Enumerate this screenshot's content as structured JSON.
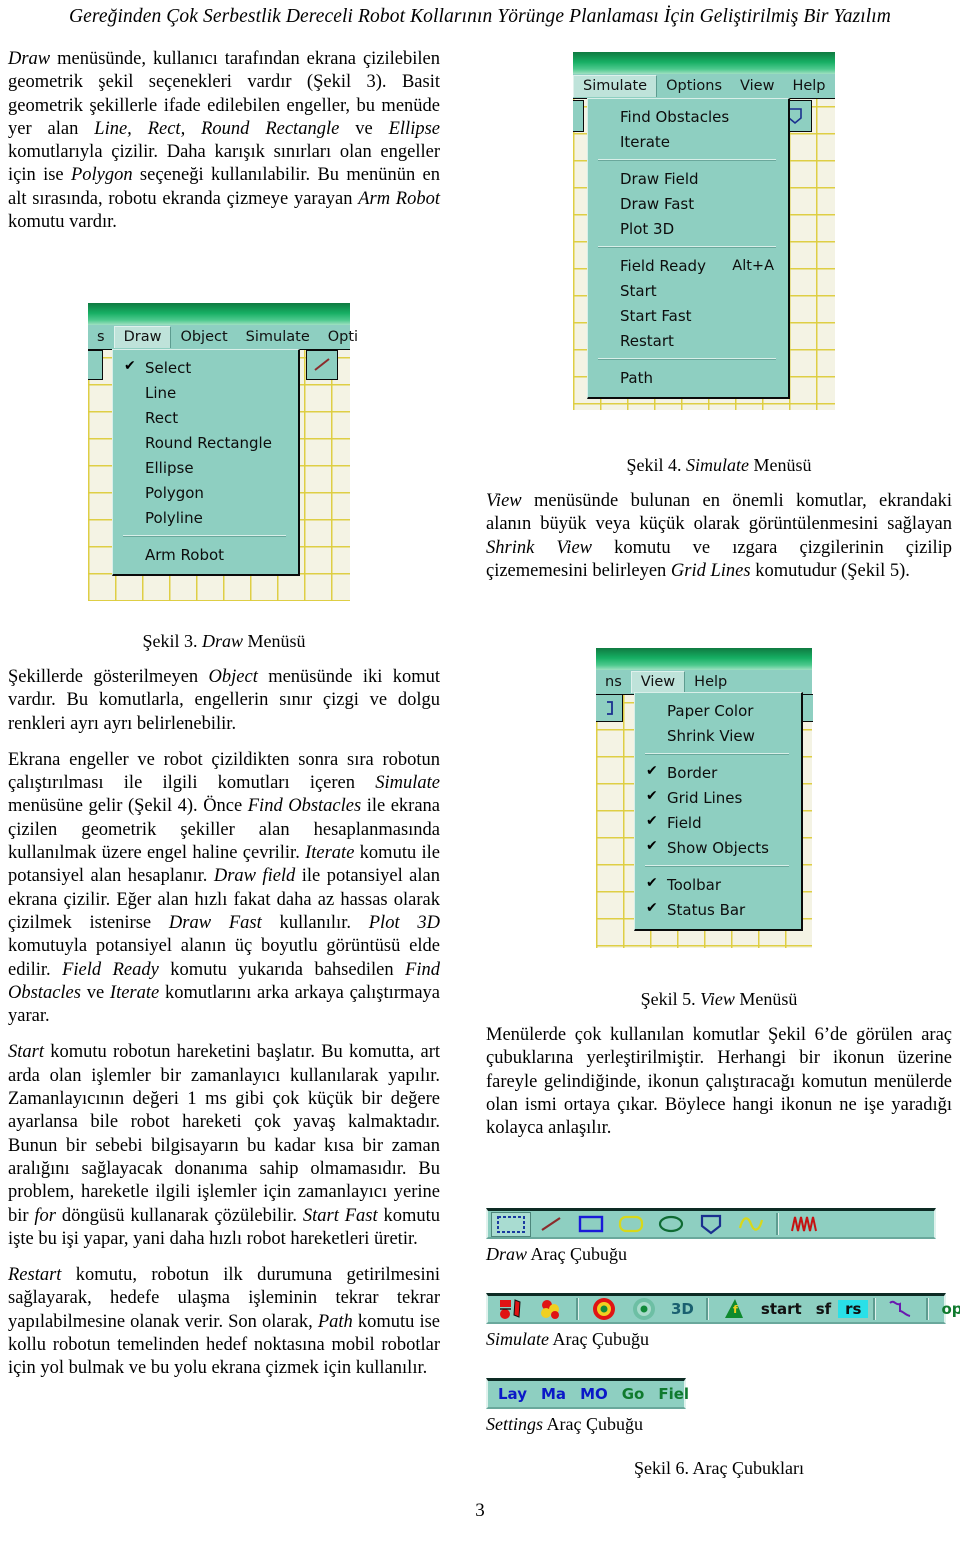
{
  "header": {
    "title": "Gereğinden Çok Serbestlik Dereceli Robot Kollarının Yörünge Planlaması İçin Geliştirilmiş Bir Yazılım"
  },
  "page_number": "3",
  "left_column": {
    "p1_html": "<i>Draw</i> menüsünde, kullanıcı tarafından ekrana çizilebilen geometrik şekil seçenekleri vardır (Şekil 3). Basit geometrik şekillerle ifade edilebilen engeller, bu menüde yer alan <i>Line, Rect, Round Rectangle</i> ve <i>Ellipse</i> komutlarıyla çizilir. Daha karışık sınırları olan engeller için ise <i>Polygon</i> seçeneği kullanılabilir. Bu menünün en alt sırasında, robotu ekranda çizmeye yarayan <i>Arm Robot</i> komutu vardır.",
    "fig3_caption_html": "Şekil 3. <i>Draw</i> Menüsü",
    "p2_html": "Şekillerde gösterilmeyen <i>Object</i> menüsünde iki komut vardır. Bu komutlarla, engellerin sınır çizgi ve dolgu renkleri ayrı ayrı belirlenebilir.",
    "p3_html": "Ekrana engeller ve robot çizildikten sonra sıra robotun çalıştırılması ile ilgili komutları içeren <i>Simulate</i> menüsüne gelir (Şekil 4). Önce <i>Find Obstacles</i> ile ekrana çizilen geometrik şekiller alan hesaplanmasında kullanılmak üzere engel haline çevrilir. <i>Iterate</i> komutu ile potansiyel alan hesaplanır. <i>Draw field</i> ile potansiyel alan ekrana çizilir. Eğer alan hızlı fakat daha az hassas olarak çizilmek istenirse <i>Draw Fast</i> kullanılır. <i>Plot 3D</i> komutuyla potansiyel alanın üç boyutlu görüntüsü elde edilir. <i>Field Ready</i> komutu yukarıda bahsedilen <i>Find Obstacles</i> ve <i>Iterate</i> komutlarını arka arkaya çalıştırmaya yarar.",
    "p4_html": "<i>Start</i> komutu robotun hareketini başlatır. Bu komutta, art arda olan işlemler bir zamanlayıcı kullanılarak yapılır. Zamanlayıcının değeri 1 ms gibi çok küçük bir değere ayarlansa bile robot hareketi çok yavaş kalmaktadır. Bunun bir sebebi bilgisayarın bu kadar kısa bir zaman aralığını sağlayacak donanıma sahip olmamasıdır. Bu problem, hareketle ilgili işlemler için zamanlayıcı yerine bir <i>for</i> döngüsü kullanarak çözülebilir. <i>Start Fast</i> komutu işte bu işi yapar, yani daha hızlı robot hareketleri üretir.",
    "p5_html": "<i>Restart</i> komutu, robotun ilk durumuna getirilmesini sağlayarak, hedefe ulaşma işleminin tekrar tekrar yapılabilmesine olanak verir. Son olarak, <i>Path</i> komutu ise kollu robotun temelinden hedef noktasına mobil robotlar için yol bulmak ve bu yolu ekrana çizmek için kullanılır."
  },
  "right_column": {
    "fig4_caption_html": "Şekil 4. <i>Simulate</i> Menüsü",
    "p1_html": "<i>View</i> menüsünde bulunan en önemli komutlar, ekrandaki alanın büyük veya küçük olarak görüntülenmesini sağlayan <i>Shrink View</i> komutu ve ızgara çizgilerinin çizilip çizememesini belirleyen <i>Grid Lines</i> komutudur (Şekil 5).",
    "fig5_caption_html": "Şekil 5. <i>View</i> Menüsü",
    "p2_html": "Menülerde çok kullanılan komutlar Şekil 6’de görülen araç çubuklarına yerleştirilmiştir. Herhangi bir ikonun üzerine fareyle gelindiğinde, ikonun çalıştıracağı komutun menülerde olan ismi ortaya çıkar. Böylece hangi ikonun ne işe yaradığı kolayca anlaşılır.",
    "draw_toolbar_label_html": "<i>Draw</i> Araç Çubuğu",
    "simulate_toolbar_label_html": "<i>Simulate</i> Araç Çubuğu",
    "settings_toolbar_label_html": "<i>Settings</i> Araç Çubuğu",
    "fig6_caption": "Şekil 6. Araç Çubukları"
  },
  "figure3_draw_menu": {
    "menubar": [
      {
        "label": "s",
        "selected": false
      },
      {
        "label": "Draw",
        "selected": true
      },
      {
        "label": "Object",
        "selected": false
      },
      {
        "label": "Simulate",
        "selected": false
      },
      {
        "label": "Opti",
        "selected": false
      }
    ],
    "items": [
      {
        "label": "Select",
        "checked": true
      },
      {
        "label": "Line",
        "checked": false
      },
      {
        "label": "Rect",
        "checked": false
      },
      {
        "label": "Round Rectangle",
        "checked": false
      },
      {
        "label": "Ellipse",
        "checked": false
      },
      {
        "label": "Polygon",
        "checked": false
      },
      {
        "label": "Polyline",
        "checked": false
      },
      {
        "separator": true
      },
      {
        "label": "Arm Robot",
        "checked": false
      }
    ]
  },
  "figure4_simulate_menu": {
    "menubar": [
      {
        "label": "Simulate",
        "selected": true
      },
      {
        "label": "Options",
        "selected": false
      },
      {
        "label": "View",
        "selected": false
      },
      {
        "label": "Help",
        "selected": false
      }
    ],
    "items": [
      {
        "label": "Find Obstacles",
        "accel": ""
      },
      {
        "label": "Iterate",
        "accel": ""
      },
      {
        "separator": true
      },
      {
        "label": "Draw Field",
        "accel": ""
      },
      {
        "label": "Draw Fast",
        "accel": ""
      },
      {
        "label": "Plot 3D",
        "accel": ""
      },
      {
        "separator": true
      },
      {
        "label": "Field Ready",
        "accel": "Alt+A"
      },
      {
        "label": "Start",
        "accel": ""
      },
      {
        "label": "Start Fast",
        "accel": ""
      },
      {
        "label": "Restart",
        "accel": ""
      },
      {
        "separator": true
      },
      {
        "label": "Path",
        "accel": ""
      }
    ]
  },
  "figure5_view_menu": {
    "menubar": [
      {
        "label": "ns",
        "selected": false
      },
      {
        "label": "View",
        "selected": true
      },
      {
        "label": "Help",
        "selected": false
      }
    ],
    "items": [
      {
        "label": "Paper Color",
        "checked": false
      },
      {
        "label": "Shrink View",
        "checked": false
      },
      {
        "separator": true
      },
      {
        "label": "Border",
        "checked": true
      },
      {
        "label": "Grid Lines",
        "checked": true
      },
      {
        "label": "Field",
        "checked": true
      },
      {
        "label": "Show Objects",
        "checked": true
      },
      {
        "separator": true
      },
      {
        "label": "Toolbar",
        "checked": true
      },
      {
        "label": "Status Bar",
        "checked": true
      }
    ]
  },
  "figure6_toolbars": {
    "draw_tools": [
      {
        "name": "select-tool",
        "pressed": true
      },
      {
        "name": "line-tool",
        "pressed": false
      },
      {
        "name": "rect-tool",
        "pressed": false
      },
      {
        "name": "round-rectangle-tool",
        "pressed": false
      },
      {
        "name": "ellipse-tool",
        "pressed": false
      },
      {
        "name": "polygon-tool",
        "pressed": false
      },
      {
        "name": "polyline-tool",
        "pressed": false
      },
      {
        "name": "arm-robot-tool",
        "pressed": false
      }
    ],
    "simulate_tools": [
      {
        "name": "find-obstacles-tool",
        "label": ""
      },
      {
        "name": "iterate-tool",
        "label": ""
      },
      {
        "name": "draw-field-tool",
        "label": ""
      },
      {
        "name": "draw-fast-tool",
        "label": ""
      },
      {
        "name": "plot-3d-tool",
        "label": "3D"
      },
      {
        "name": "field-ready-tool",
        "label": ""
      },
      {
        "name": "start-tool",
        "label": "start"
      },
      {
        "name": "start-fast-tool",
        "label": "sf"
      },
      {
        "name": "restart-tool",
        "label": "rs"
      },
      {
        "name": "path-tool",
        "label": ""
      },
      {
        "name": "options-tool",
        "label": "opt"
      },
      {
        "name": "lines-tool",
        "label": ""
      }
    ],
    "settings_tools": [
      {
        "name": "layer-button",
        "label": "Lay",
        "color": "#0b18c8"
      },
      {
        "name": "ma-button",
        "label": "Ma",
        "color": "#0b18c8"
      },
      {
        "name": "mo-button",
        "label": "MO",
        "color": "#0b18c8"
      },
      {
        "name": "go-button",
        "label": "Go",
        "color": "#0f7a2e"
      },
      {
        "name": "fiel-button",
        "label": "Fiel",
        "color": "#0f7a2e"
      }
    ]
  },
  "colors": {
    "titlebar_green": "#16ae63",
    "menu_teal": "#8ecfc1",
    "grid_yellow": "#decd3c",
    "paper": "#f4f3e4"
  }
}
